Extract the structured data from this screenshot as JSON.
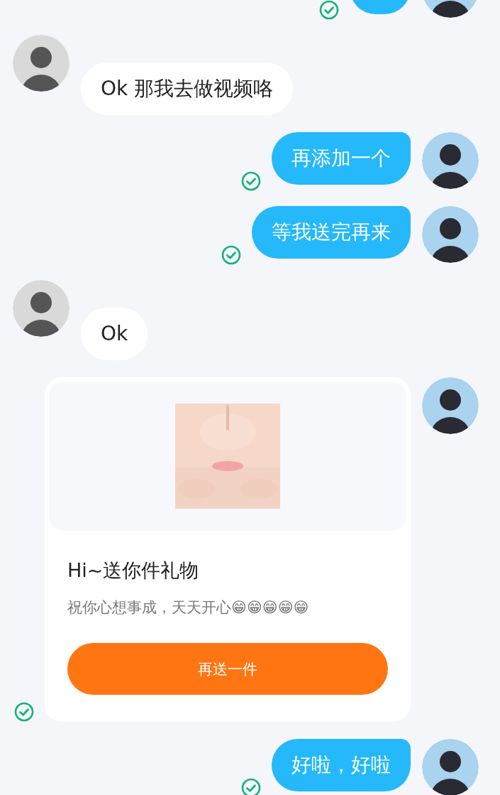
{
  "messages": [
    {
      "outgoing": true,
      "kind": "text",
      "read": true
    },
    {
      "outgoing": false,
      "kind": "text",
      "text": "Ok 那我去做视频咯"
    },
    {
      "outgoing": true,
      "kind": "text",
      "read": true,
      "text": "再添加一个"
    },
    {
      "outgoing": true,
      "kind": "text",
      "read": true,
      "text": "等我送完再来"
    },
    {
      "outgoing": false,
      "kind": "text",
      "text": "Ok"
    },
    {
      "outgoing": true,
      "kind": "gift",
      "read": true,
      "gift": {
        "title": "Hi~送你件礼物",
        "subtitle": "祝你心想事成，天天开心😁😁😁😁😁",
        "button": "再送一件"
      }
    },
    {
      "outgoing": true,
      "kind": "text",
      "read": true,
      "text": "好啦，好啦"
    }
  ]
}
